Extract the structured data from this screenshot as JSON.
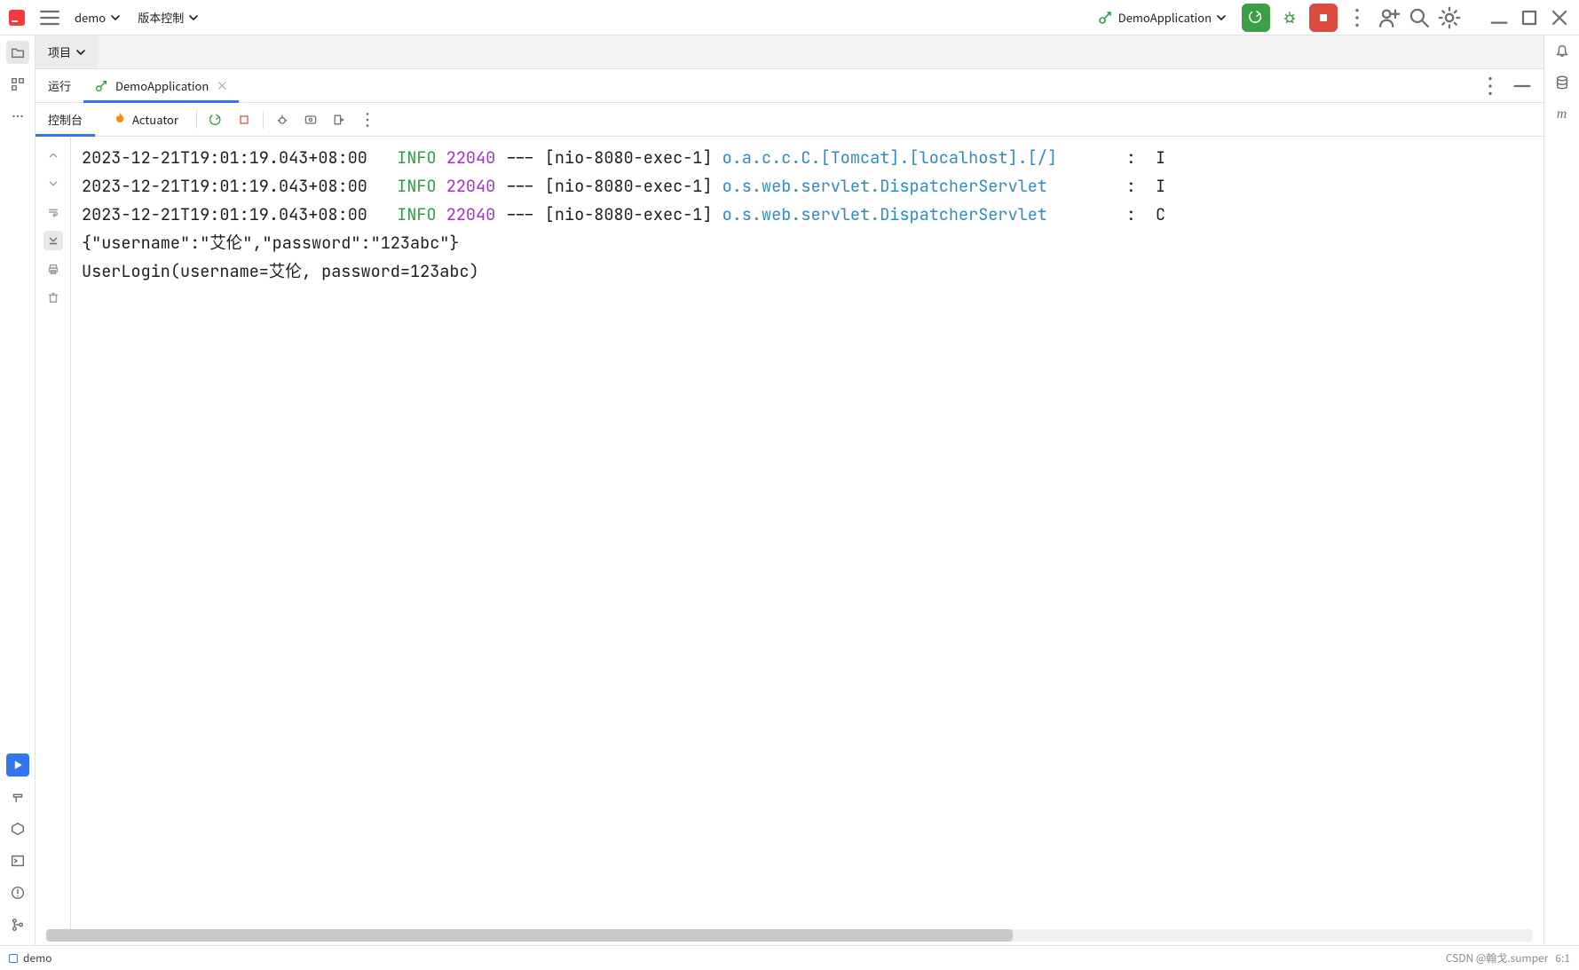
{
  "toolbar": {
    "project_name": "demo",
    "vcs_label": "版本控制",
    "run_config": "DemoApplication"
  },
  "project_panel": {
    "title": "项目"
  },
  "run_tool": {
    "label": "运行",
    "tab": "DemoApplication",
    "console_tab": "控制台",
    "actuator_tab": "Actuator"
  },
  "console": {
    "lines": [
      {
        "ts": "2023-12-21T19:01:19.043+08:00",
        "lvl": "INFO",
        "pid": "22040",
        "dash": "---",
        "thread": "[nio-8080-exec-1]",
        "logger": "o.a.c.c.C.[Tomcat].[localhost].[/]",
        "tail": ":  I"
      },
      {
        "ts": "2023-12-21T19:01:19.043+08:00",
        "lvl": "INFO",
        "pid": "22040",
        "dash": "---",
        "thread": "[nio-8080-exec-1]",
        "logger": "o.s.web.servlet.DispatcherServlet",
        "tail": ":  I"
      },
      {
        "ts": "2023-12-21T19:01:19.043+08:00",
        "lvl": "INFO",
        "pid": "22040",
        "dash": "---",
        "thread": "[nio-8080-exec-1]",
        "logger": "o.s.web.servlet.DispatcherServlet",
        "tail": ":  C"
      }
    ],
    "plain": [
      "{\"username\":\"艾伦\",\"password\":\"123abc\"}",
      "UserLogin(username=艾伦, password=123abc)"
    ]
  },
  "status": {
    "module": "demo",
    "watermark": "CSDN @翰戈.sumper",
    "cursor": "6:1"
  }
}
